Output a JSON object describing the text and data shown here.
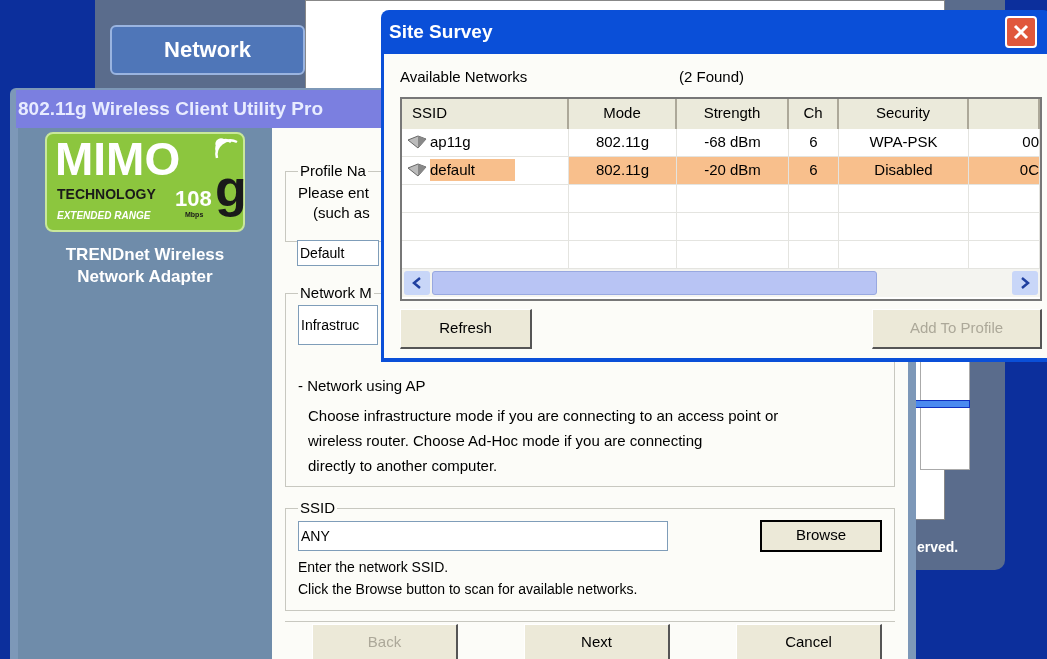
{
  "background_window": {
    "nav_button": "Network",
    "footer_text": "erved."
  },
  "profile_window": {
    "title": "802.11g Wireless Client Utility Pro",
    "logo": {
      "brand": "MIMO",
      "technology": "TECHNOLOGY",
      "speed": "108",
      "letter": "g",
      "unit": "Mbps",
      "range": "EXTENDED RANGE"
    },
    "product": "TRENDnet Wireless Network Adapter",
    "profile_group": {
      "legend": "Profile Na",
      "prompt_lines": [
        "Please ent",
        "(such as"
      ],
      "value": "Default"
    },
    "mode_group": {
      "legend": "Network M",
      "value": "Infrastruc",
      "mode_title": "- Network using AP",
      "description_lines": [
        "Choose infrastructure mode if you are connecting to an access point or",
        "wireless router. Choose Ad-Hoc mode if you are connecting",
        "directly to another computer."
      ]
    },
    "ssid_group": {
      "legend": "SSID",
      "value": "ANY",
      "browse": "Browse",
      "help_lines": [
        "Enter the network SSID.",
        "Click the Browse button to scan for available networks."
      ]
    },
    "buttons": [
      {
        "label": "Back",
        "disabled": true
      },
      {
        "label": "Next",
        "disabled": false
      },
      {
        "label": "Cancel",
        "disabled": false
      }
    ]
  },
  "site_survey": {
    "title": "Site Survey",
    "available_label": "Available Networks",
    "found": "(2 Found)",
    "columns": [
      "SSID",
      "Mode",
      "Strength",
      "Ch",
      "Security"
    ],
    "rows": [
      {
        "cells": [
          "ap11g",
          "802.11g",
          "-68 dBm",
          "6",
          "WPA-PSK",
          "00"
        ],
        "selected": false
      },
      {
        "cells": [
          "default",
          "802.11g",
          "-20 dBm",
          "6",
          "Disabled",
          "0C"
        ],
        "selected": true
      }
    ],
    "buttons": [
      {
        "label": "Refresh",
        "disabled": false
      },
      {
        "label": "Add To Profile",
        "disabled": true
      }
    ]
  }
}
